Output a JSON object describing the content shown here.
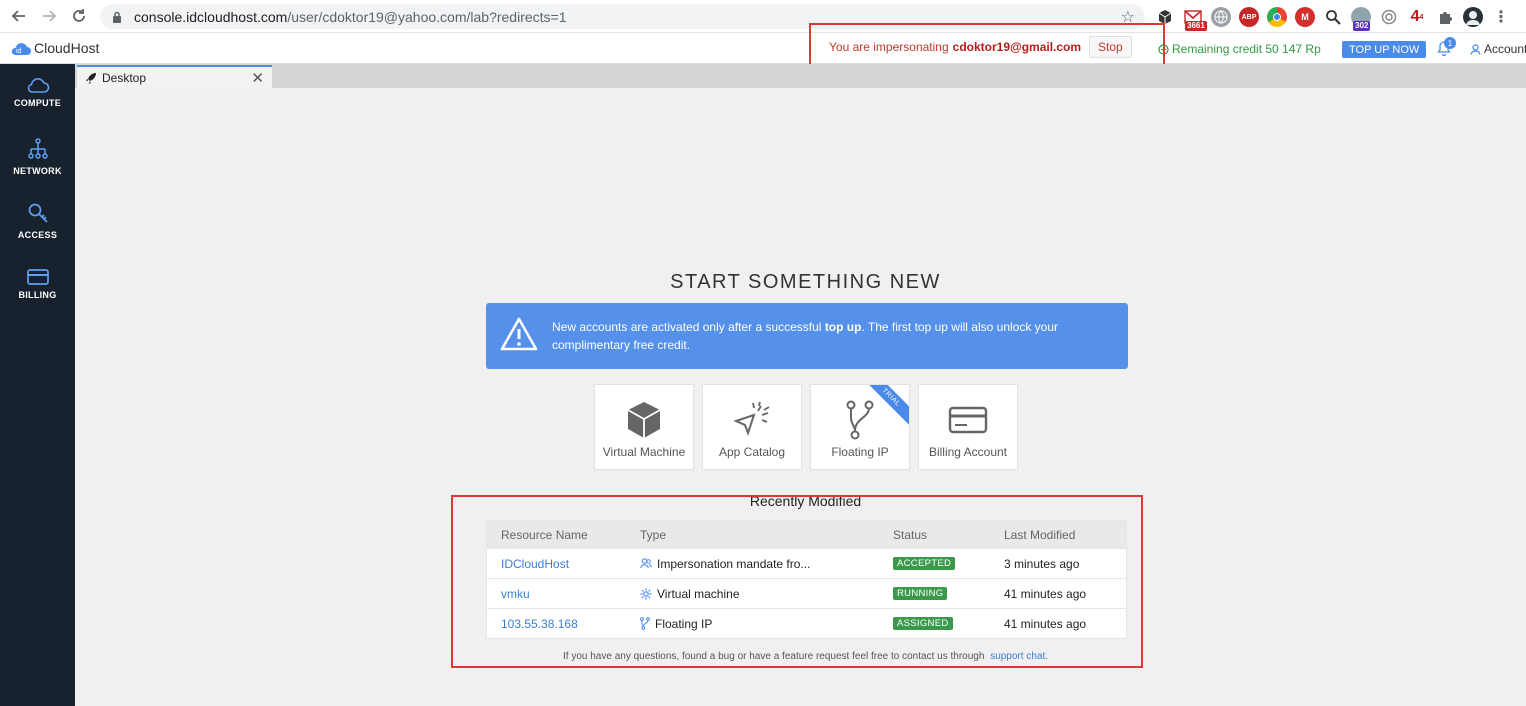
{
  "browser": {
    "url_host": "console.idcloudhost.com",
    "url_path": "/user/cdoktor19@yahoo.com/lab?redirects=1",
    "extensions": [
      {
        "name": "cube-icon",
        "badge": ""
      },
      {
        "name": "gmail-icon",
        "badge": "3661"
      },
      {
        "name": "globe-icon",
        "badge": ""
      },
      {
        "name": "adblock-icon",
        "badge": ""
      },
      {
        "name": "chrome-color-icon",
        "badge": ""
      },
      {
        "name": "mail-m-icon",
        "badge": ""
      },
      {
        "name": "magnifier-icon",
        "badge": ""
      },
      {
        "name": "ext-302-icon",
        "badge": "302"
      },
      {
        "name": "circle-ext-icon",
        "badge": ""
      },
      {
        "name": "ext-4-icon",
        "badge": ""
      },
      {
        "name": "puzzle-icon",
        "badge": ""
      },
      {
        "name": "profile-avatar",
        "badge": ""
      }
    ]
  },
  "header": {
    "logo_text": "CloudHost",
    "logo_prefix": "id",
    "impersonating_prefix": "You are impersonating",
    "impersonating_email": "cdoktor19@gmail.com",
    "stop_label": "Stop",
    "credit_text": "Remaining credit 50 147 Rp",
    "topup_label": "TOP UP NOW",
    "notifications_count": "1",
    "account_label": "Account"
  },
  "sidebar": {
    "items": [
      {
        "label": "COMPUTE",
        "icon": "cloud-icon"
      },
      {
        "label": "NETWORK",
        "icon": "network-icon"
      },
      {
        "label": "ACCESS",
        "icon": "key-icon"
      },
      {
        "label": "BILLING",
        "icon": "card-icon"
      }
    ]
  },
  "tabs": [
    {
      "label": "Desktop",
      "icon": "rocket-icon"
    }
  ],
  "main": {
    "heading": "START SOMETHING NEW",
    "alert_before": "New accounts are activated only after a successful ",
    "alert_bold": "top up",
    "alert_after": ". The first top up will also unlock your complimentary free credit.",
    "cards": [
      {
        "label": "Virtual Machine",
        "icon": "cube-icon"
      },
      {
        "label": "App Catalog",
        "icon": "cursor-burst-icon"
      },
      {
        "label": "Floating IP",
        "icon": "branch-icon",
        "ribbon": "TRIAL"
      },
      {
        "label": "Billing Account",
        "icon": "card-icon"
      }
    ],
    "recent_title": "Recently Modified",
    "columns": [
      "Resource Name",
      "Type",
      "Status",
      "Last Modified"
    ],
    "rows": [
      {
        "name": "IDCloudHost",
        "type": "Impersonation mandate fro...",
        "type_icon": "users-icon",
        "status": "ACCEPTED",
        "modified": "3 minutes ago"
      },
      {
        "name": "vmku",
        "type": "Virtual machine",
        "type_icon": "gear-icon",
        "status": "RUNNING",
        "modified": "41 minutes ago"
      },
      {
        "name": "103.55.38.168",
        "type": "Floating IP",
        "type_icon": "branch-icon",
        "status": "ASSIGNED",
        "modified": "41 minutes ago"
      }
    ],
    "footnote_text": "If you have any questions, found a bug or have a feature request feel free to contact us through",
    "footnote_link": "support chat."
  },
  "colors": {
    "accent": "#4a8ae8",
    "sidebar_bg": "#17222e",
    "status_green": "#3a9a4a",
    "highlight_red": "#d93a35",
    "credit_green": "#2e9a3e"
  }
}
